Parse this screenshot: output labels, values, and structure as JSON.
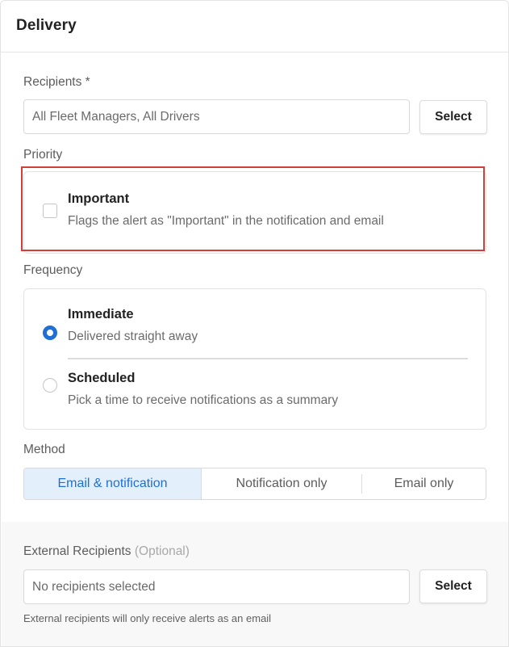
{
  "panel": {
    "title": "Delivery"
  },
  "recipients": {
    "label": "Recipients *",
    "value": "All Fleet Managers, All Drivers",
    "select_label": "Select"
  },
  "priority": {
    "label": "Priority",
    "option": {
      "title": "Important",
      "description": "Flags the alert as \"Important\" in the notification and email",
      "checked": false
    }
  },
  "frequency": {
    "label": "Frequency",
    "options": [
      {
        "title": "Immediate",
        "description": "Delivered straight away",
        "selected": true
      },
      {
        "title": "Scheduled",
        "description": "Pick a time to receive notifications as a summary",
        "selected": false
      }
    ]
  },
  "method": {
    "label": "Method",
    "options": [
      "Email & notification",
      "Notification only",
      "Email only"
    ],
    "selected": "Email & notification"
  },
  "external": {
    "label": "External Recipients",
    "optional_tag": "(Optional)",
    "placeholder": "No recipients selected",
    "select_label": "Select",
    "help_text": "External recipients will only receive alerts as an email"
  },
  "colors": {
    "accent": "#1e6fd6",
    "highlight_border": "#d0403a",
    "selected_segment_bg": "#e3f0fc"
  }
}
